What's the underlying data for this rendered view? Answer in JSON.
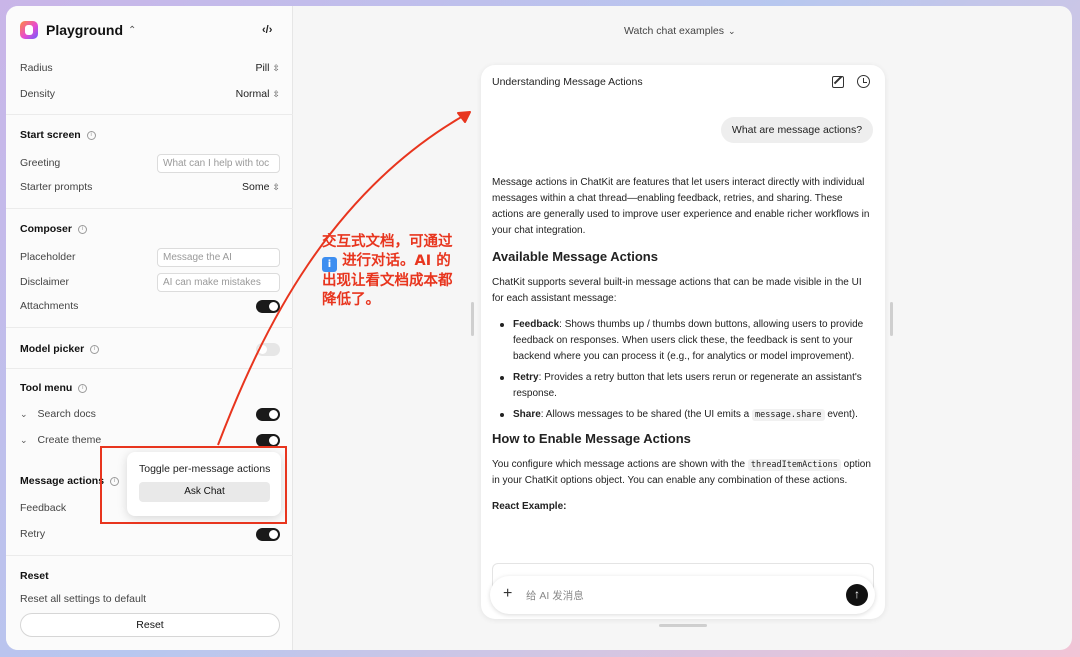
{
  "sidebar": {
    "app_title": "Playground",
    "code_toggle_icon": "code-icon",
    "radius": {
      "label": "Radius",
      "value": "Pill"
    },
    "density": {
      "label": "Density",
      "value": "Normal"
    },
    "start_screen": {
      "title": "Start screen",
      "greeting_label": "Greeting",
      "greeting_placeholder": "What can I help with toc",
      "starter_label": "Starter prompts",
      "starter_value": "Some"
    },
    "composer": {
      "title": "Composer",
      "placeholder_label": "Placeholder",
      "placeholder_value": "Message the AI",
      "disclaimer_label": "Disclaimer",
      "disclaimer_value": "AI can make mistakes",
      "attachments_label": "Attachments",
      "attachments_on": true
    },
    "model_picker": {
      "title": "Model picker",
      "on": false
    },
    "tool_menu": {
      "title": "Tool menu",
      "items": [
        {
          "label": "Search docs",
          "on": true
        },
        {
          "label": "Create theme",
          "on": true
        }
      ]
    },
    "message_actions": {
      "title": "Message actions",
      "feedback_label": "Feedback",
      "retry_label": "Retry"
    },
    "reset": {
      "title": "Reset",
      "description": "Reset all settings to default",
      "button": "Reset"
    }
  },
  "tooltip": {
    "text": "Toggle per-message actions",
    "button": "Ask Chat"
  },
  "main": {
    "watch_examples": "Watch chat examples"
  },
  "chat": {
    "title": "Understanding Message Actions",
    "user_message": "What are message actions?",
    "intro": "Message actions in ChatKit are features that let users interact directly with individual messages within a chat thread—enabling feedback, retries, and sharing. These actions are generally used to improve user experience and enable richer workflows in your chat integration.",
    "h_available": "Available Message Actions",
    "available_text": "ChatKit supports several built-in message actions that can be made visible in the UI for each assistant message:",
    "bullets": [
      {
        "term": "Feedback",
        "text": ": Shows thumbs up / thumbs down buttons, allowing users to provide feedback on responses. When users click these, the feedback is sent to your backend where you can process it (e.g., for analytics or model improvement)."
      },
      {
        "term": "Retry",
        "text": ": Provides a retry button that lets users rerun or regenerate an assistant's response."
      },
      {
        "term": "Share",
        "text_before": ": Allows messages to be shared (the UI emits a ",
        "code": "message.share",
        "text_after": " event)."
      }
    ],
    "h_enable": "How to Enable Message Actions",
    "enable_before": "You configure which message actions are shown with the ",
    "enable_code": "threadItemActions",
    "enable_after": " option in your ChatKit options object. You can enable any combination of these actions.",
    "react_example": "React Example:",
    "composer_placeholder": "给 AI 发消息"
  },
  "annotation": {
    "line1": "交互式文档，可通过",
    "badge": "i",
    "line2": "进行对话。AI 的",
    "line3": "出现让看文档成本都",
    "line4": "降低了。",
    "color": "#e8351e"
  }
}
